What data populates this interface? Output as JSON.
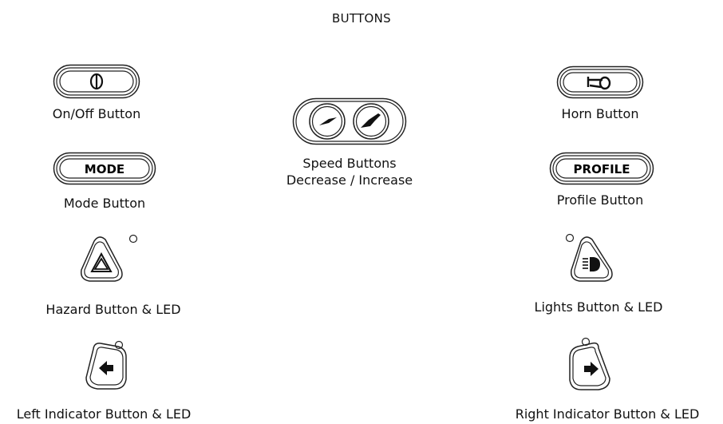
{
  "title": "BUTTONS",
  "buttons": {
    "onoff": {
      "label": "On/Off Button",
      "icon": "power-icon"
    },
    "mode": {
      "label": "Mode Button",
      "face_text": "MODE"
    },
    "hazard": {
      "label": "Hazard Button & LED",
      "icon": "hazard-triangle-icon"
    },
    "left_indicator": {
      "label": "Left Indicator Button & LED",
      "icon": "arrow-left-icon"
    },
    "speed": {
      "label_line1": "Speed Buttons",
      "label_line2": "Decrease / Increase",
      "icons": [
        "speed-decrease-icon",
        "speed-increase-icon"
      ]
    },
    "horn": {
      "label": "Horn Button",
      "icon": "horn-icon"
    },
    "profile": {
      "label": "Profile Button",
      "face_text": "PROFILE"
    },
    "lights": {
      "label": "Lights Button & LED",
      "icon": "headlight-icon"
    },
    "right_indicator": {
      "label": "Right Indicator Button & LED",
      "icon": "arrow-right-icon"
    }
  }
}
